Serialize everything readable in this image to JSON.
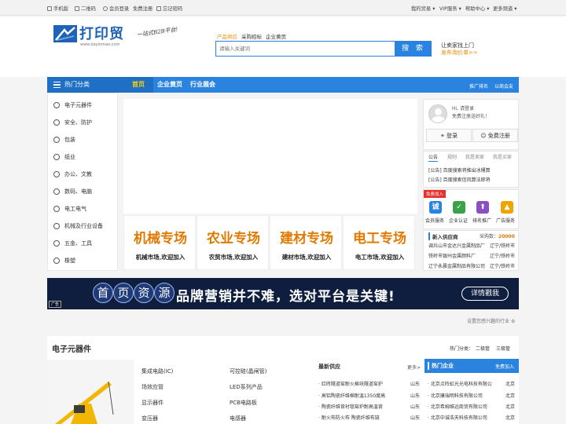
{
  "topbar": {
    "left": [
      "手机版",
      "二维码",
      "会员登录",
      "免费注册",
      "忘记密码"
    ],
    "right": [
      "我的贸易",
      "VIP服务",
      "帮助中心",
      "更多频道"
    ]
  },
  "header": {
    "logo_text": "打印贸",
    "logo_url": "www.dayinmao.com",
    "slogan": "一站式B2B平台!",
    "search_tabs": [
      "产品供应",
      "采购招标",
      "企业黄页"
    ],
    "search_placeholder": "请输入关键词",
    "search_button": "搜 索",
    "right_line1": "让卖家找上门",
    "right_line2": "发布询价单>>"
  },
  "nav": {
    "category": "热门分类",
    "items": [
      "首页",
      "企业黄页",
      "行业展会"
    ],
    "right_links": [
      "推广排名",
      "以商会友"
    ]
  },
  "sidebar": {
    "items": [
      "电子元器件",
      "安全、防护",
      "包装",
      "纸业",
      "办公、文教",
      "数码、电脑",
      "电工电气",
      "机械及行业设备",
      "五金、工具",
      "橡塑"
    ]
  },
  "markets": [
    {
      "title": "机械专场",
      "sub": "机械市场,欢迎加入"
    },
    {
      "title": "农业专场",
      "sub": "农贸市场,欢迎加入"
    },
    {
      "title": "建材专场",
      "sub": "建材市场,欢迎加入"
    },
    {
      "title": "电工专场",
      "sub": "电工市场,欢迎加入"
    }
  ],
  "userbox": {
    "hi": "Hi, 请登录",
    "sub": "免费注册送好礼！",
    "login": "登录",
    "register": "免费注册"
  },
  "notices": {
    "tabs": [
      "公告",
      "规则",
      "我是卖家",
      "我是买家"
    ],
    "lines": [
      "[公告] 百度搜索将推出冰桶算",
      "[公告] 百度搜索信风算法即将"
    ]
  },
  "services": {
    "badge": "免费加入",
    "items": [
      {
        "label": "会员服务",
        "glyph": "诚",
        "color": "#2a83df"
      },
      {
        "label": "企业认证",
        "glyph": "✓",
        "color": "#3aa34a"
      },
      {
        "label": "排名推广",
        "glyph": "⬆",
        "color": "#8b4fc2"
      },
      {
        "label": "广告服务",
        "glyph": "▲",
        "color": "#f0a400"
      }
    ]
  },
  "supply": {
    "title": "新入供应商",
    "count_label": "采购数：",
    "count": "20000",
    "rows": [
      {
        "name": "调兵山市金达兴金属制品厂",
        "loc": "辽宁/铁岭市"
      },
      {
        "name": "铁岭市银州金属颜料厂",
        "loc": "辽宁/铁岭市"
      },
      {
        "name": "辽宁永晨金属制品有限公司",
        "loc": "辽宁/铁岭市"
      }
    ]
  },
  "banner": {
    "chars": [
      "首",
      "页",
      "资",
      "源"
    ],
    "main": "品牌营销并不难，选对平台是关键!",
    "button": "详情戳我",
    "ad_tag": "广告"
  },
  "interest_text": "设置您感兴趣的行业",
  "section": {
    "title": "电子元器件",
    "hot_label": "热门分类：",
    "hot_links": [
      "二极管",
      "三极管"
    ],
    "products": [
      [
        "集成电路(IC)",
        "可控硅(晶闸管)"
      ],
      [
        "场效应管",
        "LED系列产品"
      ],
      [
        "显示器件",
        "PCB电路板"
      ],
      [
        "变压器",
        "电感器"
      ]
    ],
    "latest_title": "最新供应",
    "latest_more": "更多>",
    "latest": [
      {
        "name": "红砖隧道窑耐火棉块隧道窑炉",
        "loc": "山东"
      },
      {
        "name": "高铝陶瓷纤维棉耐温1350度高",
        "loc": "山东"
      },
      {
        "name": "陶瓷纤维背衬毯窑炉耐高温背",
        "loc": "山东"
      },
      {
        "name": "耐火布防火布 陶瓷纤维布链",
        "loc": "山东"
      }
    ],
    "hot_company_title": "热门企业",
    "hot_company_join": "免费加入",
    "companies": [
      {
        "name": "北京点阵虹光光电科技有限公",
        "loc": "北京"
      },
      {
        "name": "北京康瑞明科技有限公司",
        "loc": "北京"
      },
      {
        "name": "北京希姆维远商贸有限公司",
        "loc": "北京"
      },
      {
        "name": "北京中诚浩天科技有限公司",
        "loc": "北京"
      }
    ]
  }
}
